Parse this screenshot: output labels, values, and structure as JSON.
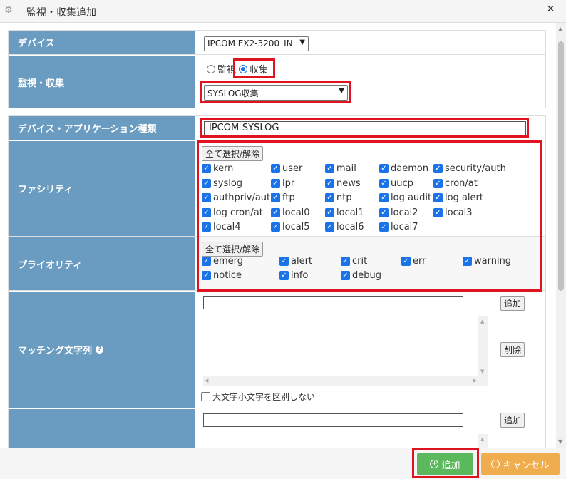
{
  "dialog": {
    "title": "監視・収集追加",
    "close": "×"
  },
  "rows": {
    "device": {
      "label": "デバイス",
      "selected": "IPCOM EX2-3200_IN"
    },
    "monitor": {
      "label": "監視・収集",
      "radio_monitor": "監視",
      "radio_collect": "収集",
      "type_selected": "SYSLOG収集"
    },
    "apptype": {
      "label": "デバイス・アプリケーション種類",
      "value": "IPCOM-SYSLOG"
    },
    "facility": {
      "label": "ファシリティ",
      "select_all": "全て選択/解除",
      "items": [
        "kern",
        "user",
        "mail",
        "daemon",
        "security/auth",
        "syslog",
        "lpr",
        "news",
        "uucp",
        "cron/at",
        "authpriv/auth",
        "ftp",
        "ntp",
        "log audit",
        "log alert",
        "log cron/at",
        "local0",
        "local1",
        "local2",
        "local3",
        "local4",
        "local5",
        "local6",
        "local7"
      ]
    },
    "priority": {
      "label": "プライオリティ",
      "select_all": "全て選択/解除",
      "items": [
        "emerg",
        "alert",
        "crit",
        "err",
        "warning",
        "notice",
        "info",
        "debug"
      ]
    },
    "matching": {
      "label": "マッチング文字列",
      "help_icon": "?",
      "add": "追加",
      "delete": "削除",
      "case_label": "大文字小文字を区別しない"
    },
    "matching2": {
      "add": "追加"
    }
  },
  "footer": {
    "add": "追加",
    "cancel": "キャンセル"
  }
}
